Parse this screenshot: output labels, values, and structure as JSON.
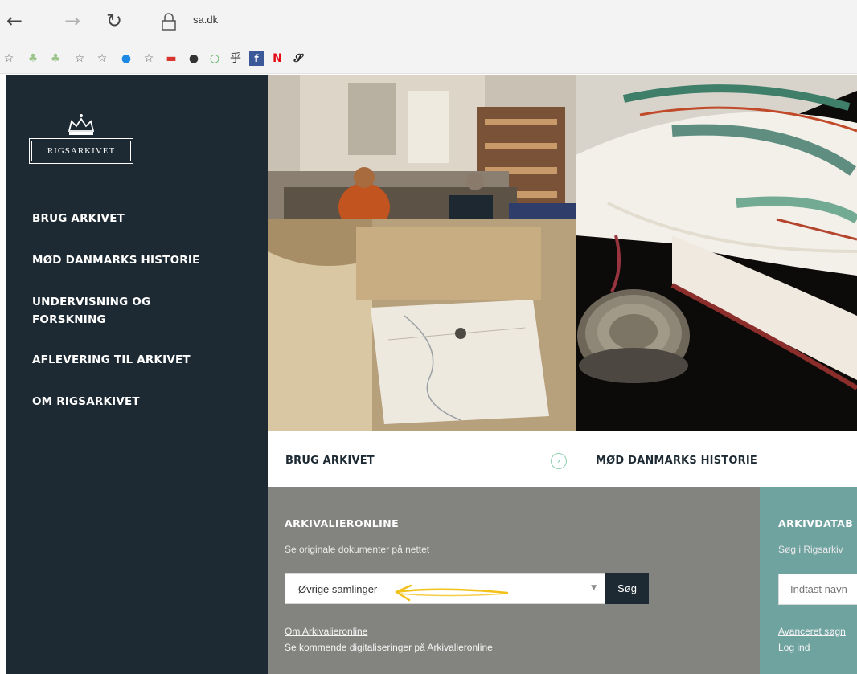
{
  "browser": {
    "back_glyph": "←",
    "forward_glyph": "→",
    "refresh_glyph": "↻",
    "url": "sa.dk"
  },
  "favorites": [
    {
      "icon": "star-icon",
      "glyph": "☆"
    },
    {
      "icon": "tree-icon",
      "glyph": "♣"
    },
    {
      "icon": "tree-icon",
      "glyph": "♣"
    },
    {
      "icon": "star-icon",
      "glyph": "☆"
    },
    {
      "icon": "star-icon",
      "glyph": "☆"
    },
    {
      "icon": "circle-blue-icon",
      "glyph": "●"
    },
    {
      "icon": "star-icon",
      "glyph": "☆"
    },
    {
      "icon": "red-bar-icon",
      "glyph": "▬"
    },
    {
      "icon": "dark-dot-icon",
      "glyph": "●"
    },
    {
      "icon": "green-ring-icon",
      "glyph": "○"
    },
    {
      "icon": "glyph-icon",
      "glyph": "乎"
    },
    {
      "icon": "facebook-icon",
      "glyph": "f"
    },
    {
      "icon": "netflix-icon",
      "glyph": "N"
    },
    {
      "icon": "script-s-icon",
      "glyph": "𝒮"
    }
  ],
  "sidebar": {
    "logo_text": "RIGSARKIVET",
    "items": [
      {
        "label": "BRUG ARKIVET"
      },
      {
        "label": "MØD DANMARKS HISTORIE"
      },
      {
        "label": "UNDERVISNING OG FORSKNING"
      },
      {
        "label": "AFLEVERING TIL ARKIVET"
      },
      {
        "label": "OM RIGSARKIVET"
      }
    ]
  },
  "tabs": [
    {
      "label": "BRUG ARKIVET",
      "arrow_glyph": "›"
    },
    {
      "label": "MØD DANMARKS HISTORIE"
    }
  ],
  "arkivalieronline": {
    "title": "ARKIVALIERONLINE",
    "subtitle": "Se originale dokumenter på nettet",
    "select_value": "Øvrige samlinger",
    "select_caret": "▼",
    "search_label": "Søg",
    "links": [
      "Om Arkivalieronline",
      "Se kommende digitaliseringer på Arkivalieronline"
    ]
  },
  "arkivdatabasen": {
    "title": "ARKIVDATAB",
    "subtitle": "Søg i Rigsarkiv",
    "input_placeholder": "Indtast navn",
    "links": [
      "Avanceret søgn",
      "Log ind"
    ]
  },
  "colors": {
    "sidebar_bg": "#1d2a33",
    "panel_gray": "#838480",
    "panel_teal": "#6fa3a0",
    "annotation_yellow": "#f2c21b"
  }
}
